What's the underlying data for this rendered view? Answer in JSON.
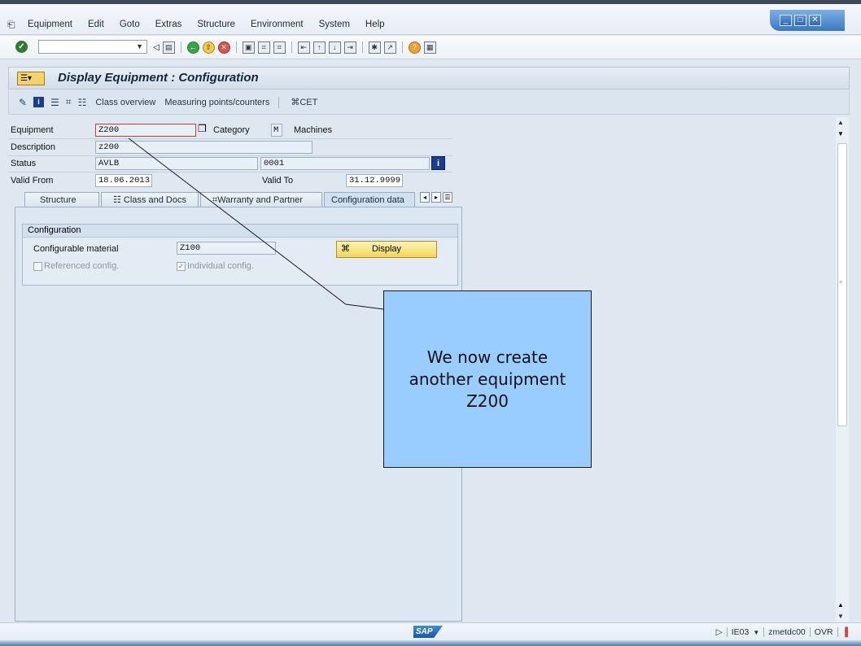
{
  "menu": [
    "Equipment",
    "Edit",
    "Goto",
    "Extras",
    "Structure",
    "Environment",
    "System",
    "Help"
  ],
  "title": "Display Equipment : Configuration",
  "app_toolbar": {
    "class_overview": "Class overview",
    "measuring_points": "Measuring points/counters",
    "cet": "CET"
  },
  "form": {
    "equipment_label": "Equipment",
    "equipment_value": "Z200",
    "category_label": "Category",
    "category_value": "M",
    "category_text": "Machines",
    "description_label": "Description",
    "description_value": "z200",
    "status_label": "Status",
    "status_value": "AVLB",
    "status_code": "0001",
    "valid_from_label": "Valid From",
    "valid_from_value": "18.06.2013",
    "valid_to_label": "Valid To",
    "valid_to_value": "31.12.9999"
  },
  "tabs": [
    "Structure",
    "Class and Docs",
    "Warranty and Partner",
    "Configuration data"
  ],
  "configuration": {
    "group_title": "Configuration",
    "material_label": "Configurable material",
    "material_value": "Z100",
    "display_button": "Display",
    "referenced_config": "Referenced config.",
    "individual_config": "Individual config."
  },
  "callout": {
    "line1": "We now create",
    "line2": "another equipment",
    "line3": "Z200"
  },
  "status": {
    "transaction": "IE03",
    "server": "zmetdc00",
    "mode": "OVR"
  },
  "colors": {
    "callout_bg": "#99ccff",
    "button_yellow": "#f3d55a"
  }
}
